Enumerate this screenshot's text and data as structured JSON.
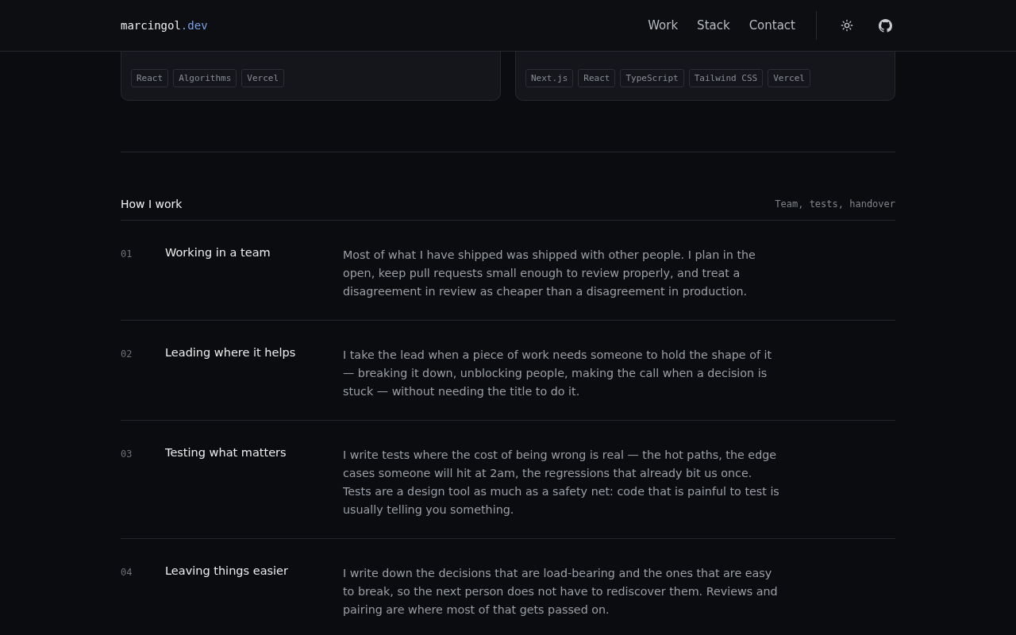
{
  "header": {
    "logo": {
      "name": "marcingol",
      "suffix": ".dev"
    },
    "nav": [
      {
        "label": "Work"
      },
      {
        "label": "Stack"
      },
      {
        "label": "Contact"
      }
    ]
  },
  "project_cards": [
    {
      "tags": [
        "React",
        "Algorithms",
        "Vercel"
      ]
    },
    {
      "tags": [
        "Next.js",
        "React",
        "TypeScript",
        "Tailwind CSS",
        "Vercel"
      ]
    }
  ],
  "section": {
    "title": "How I work",
    "subtitle": "Team, tests, handover",
    "items": [
      {
        "number": "01",
        "title": "Working in a team",
        "text": "Most of what I have shipped was shipped with other people. I plan in the open, keep pull requests small enough to review properly, and treat a disagreement in review as cheaper than a disagreement in production."
      },
      {
        "number": "02",
        "title": "Leading where it helps",
        "text": "I take the lead when a piece of work needs someone to hold the shape of it — breaking it down, unblocking people, making the call when a decision is stuck — without needing the title to do it."
      },
      {
        "number": "03",
        "title": "Testing what matters",
        "text": "I write tests where the cost of being wrong is real — the hot paths, the edge cases someone will hit at 2am, the regressions that already bit us once. Tests are a design tool as much as a safety net: code that is painful to test is usually telling you something."
      },
      {
        "number": "04",
        "title": "Leaving things easier",
        "text": "I write down the decisions that are load-bearing and the ones that are easy to break, so the next person does not have to rediscover them. Reviews and pairing are where most of that gets passed on."
      }
    ]
  }
}
